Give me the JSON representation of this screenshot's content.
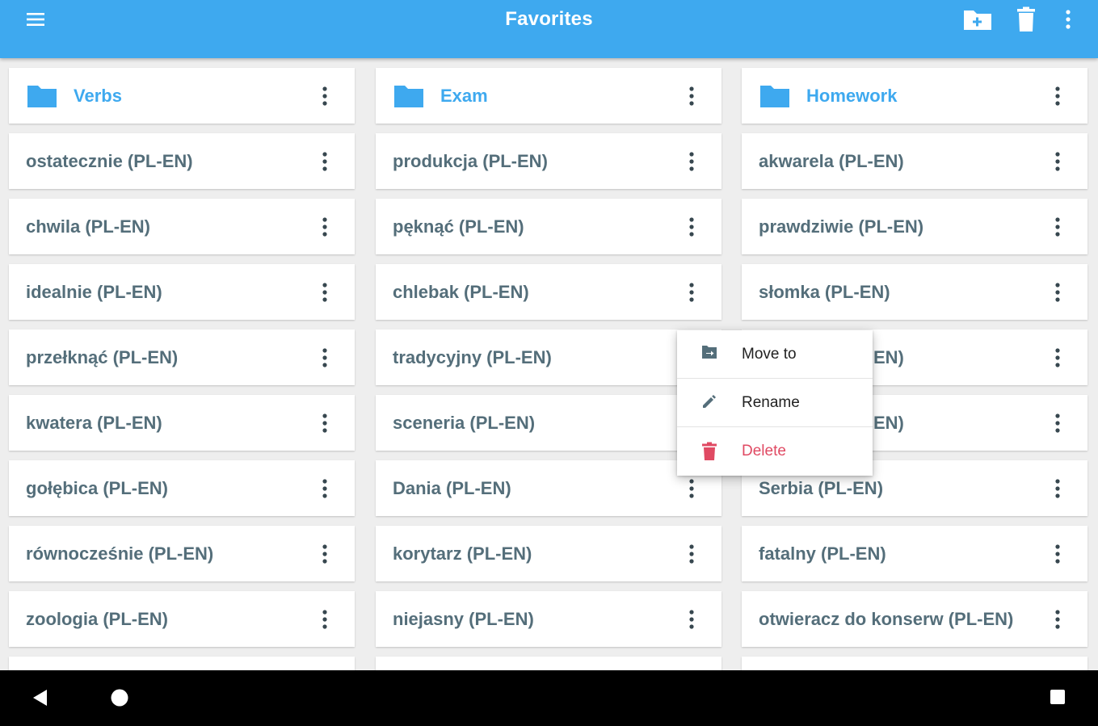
{
  "appbar": {
    "title": "Favorites",
    "menu_icon": "hamburger-menu-icon",
    "actions": [
      "new-folder-icon",
      "trash-icon",
      "more-vert-icon"
    ],
    "color": "#3ea9ef"
  },
  "columns": [
    {
      "folder": "Verbs",
      "items": [
        "ostatecznie (PL-EN)",
        "chwila (PL-EN)",
        "idealnie (PL-EN)",
        "przełknąć (PL-EN)",
        "kwatera (PL-EN)",
        "gołębica (PL-EN)",
        "równocześnie (PL-EN)",
        "zoologia (PL-EN)"
      ]
    },
    {
      "folder": "Exam",
      "items": [
        "produkcja (PL-EN)",
        "pęknąć (PL-EN)",
        "chlebak (PL-EN)",
        "tradycyjny (PL-EN)",
        "sceneria (PL-EN)",
        "Dania (PL-EN)",
        "korytarz (PL-EN)",
        "niejasny (PL-EN)"
      ]
    },
    {
      "folder": "Homework",
      "items": [
        "akwarela (PL-EN)",
        "prawdziwie (PL-EN)",
        "słomka (PL-EN)",
        "EN)",
        "EN)",
        "Serbia (PL-EN)",
        "fatalny (PL-EN)",
        "otwieracz do konserw (PL-EN)"
      ]
    }
  ],
  "context_menu": {
    "items": [
      {
        "label": "Move to",
        "icon": "move-to-folder-icon"
      },
      {
        "label": "Rename",
        "icon": "pencil-icon"
      },
      {
        "label": "Delete",
        "icon": "trash-icon",
        "color": "#e04a63"
      }
    ]
  },
  "navbar": {
    "buttons": [
      "back-icon",
      "home-icon",
      "recents-icon"
    ]
  }
}
